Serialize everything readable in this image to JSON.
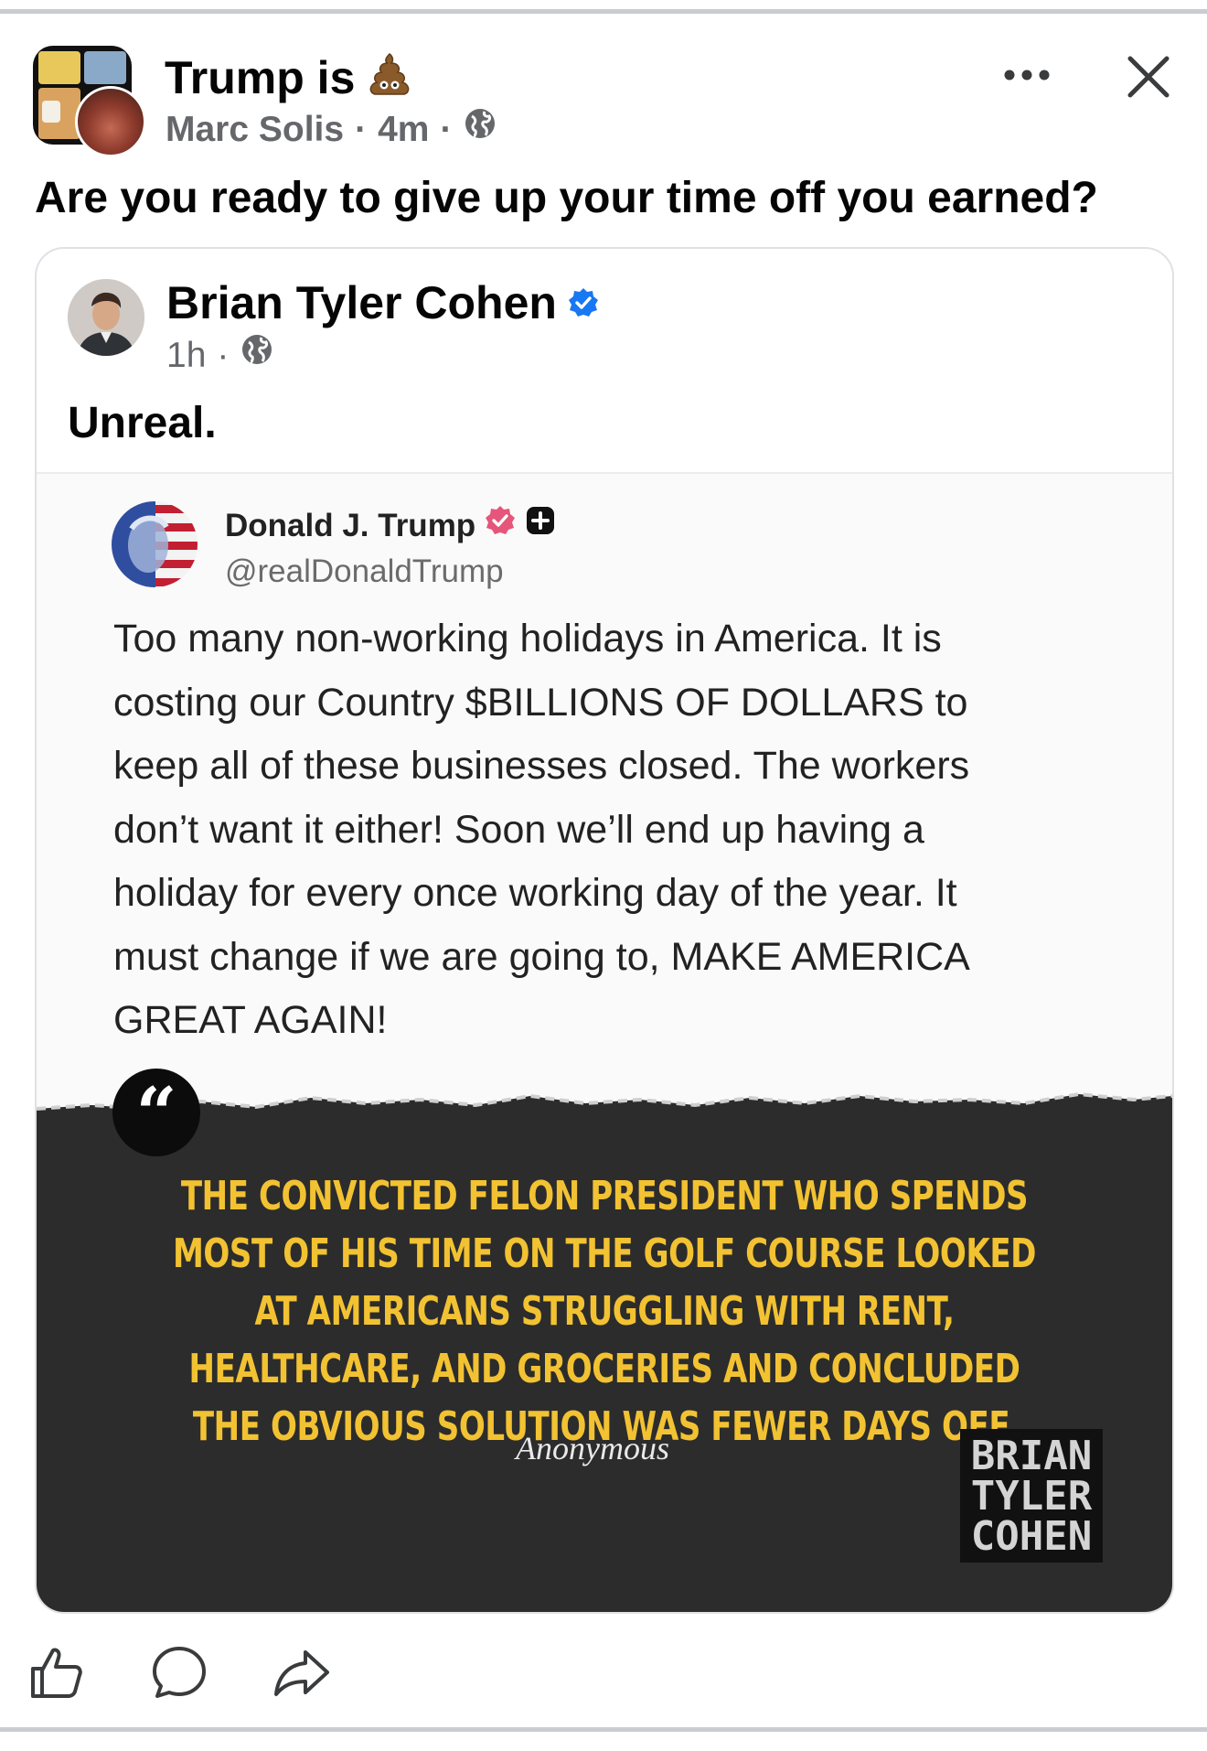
{
  "post": {
    "title": "Trump is",
    "title_emoji_icon": "poop-icon",
    "author": "Marc Solis",
    "time": "4m",
    "separator": "·",
    "audience_icon": "globe-icon",
    "text": "Are you ready to give up your time off you earned?"
  },
  "shared_post": {
    "author": "Brian Tyler Cohen",
    "verified_icon": "verified-badge-icon",
    "time": "1h",
    "text": "Unreal."
  },
  "tweet": {
    "name": "Donald J. Trump",
    "handle": "@realDonaldTrump",
    "body": "Too many non-working holidays in America. It is\ncosting our Country $BILLIONS OF DOLLARS to\nkeep all of these businesses closed. The workers\ndon’t want it either! Soon we’ll end up having a\nholiday for every once working day of the year. It\nmust change if we are going to, MAKE AMERICA\nGREAT AGAIN!"
  },
  "quote": {
    "mark": "“",
    "headline": "THE CONVICTED FELON PRESIDENT WHO SPENDS MOST OF HIS TIME ON THE GOLF COURSE LOOKED AT AMERICANS STRUGGLING WITH RENT, HEALTHCARE, AND GROCERIES AND CONCLUDED THE OBVIOUS SOLUTION WAS FEWER DAYS OFF.",
    "attribution": "Anonymous",
    "logo_lines": [
      "BRIAN",
      "TYLER",
      "COHEN"
    ]
  },
  "colors": {
    "quote_text": "#f2c232",
    "secondary_text": "#65676b",
    "verified": "#1877f2"
  },
  "actions": [
    "like-icon",
    "comment-icon",
    "share-icon"
  ]
}
